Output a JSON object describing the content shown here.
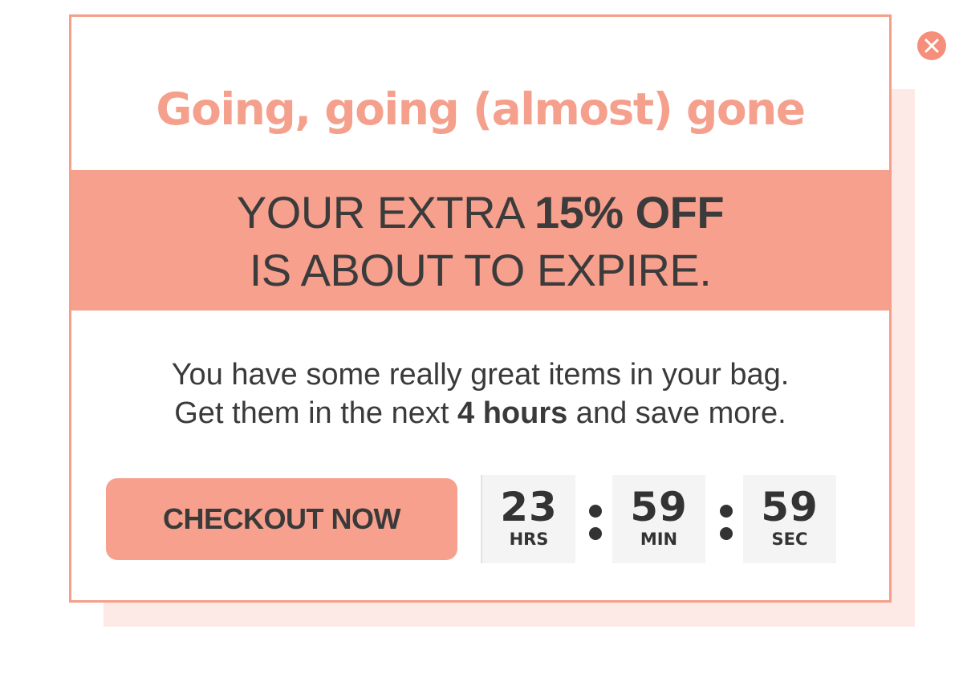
{
  "popup": {
    "title": "Going, going (almost) gone",
    "banner": {
      "line1_prefix": "YOUR EXTRA ",
      "line1_bold": "15% OFF",
      "line2": "IS ABOUT TO EXPIRE."
    },
    "message": {
      "line1": "You have some really great items in your bag.",
      "line2_prefix": "Get them in the next ",
      "line2_bold": "4 hours",
      "line2_suffix": " and save more."
    },
    "checkout_label": "CHECKOUT NOW",
    "countdown": {
      "hours": "23",
      "hours_unit": "HRS",
      "minutes": "59",
      "minutes_unit": "MIN",
      "seconds": "59",
      "seconds_unit": "SEC"
    },
    "close_icon": "close-icon"
  },
  "colors": {
    "accent": "#f6a08d",
    "border": "#f49f89",
    "title": "#f5a08c",
    "shadow": "#fdeae6",
    "text_dark": "#3a3a3a",
    "timer_bg": "#f4f4f4"
  }
}
